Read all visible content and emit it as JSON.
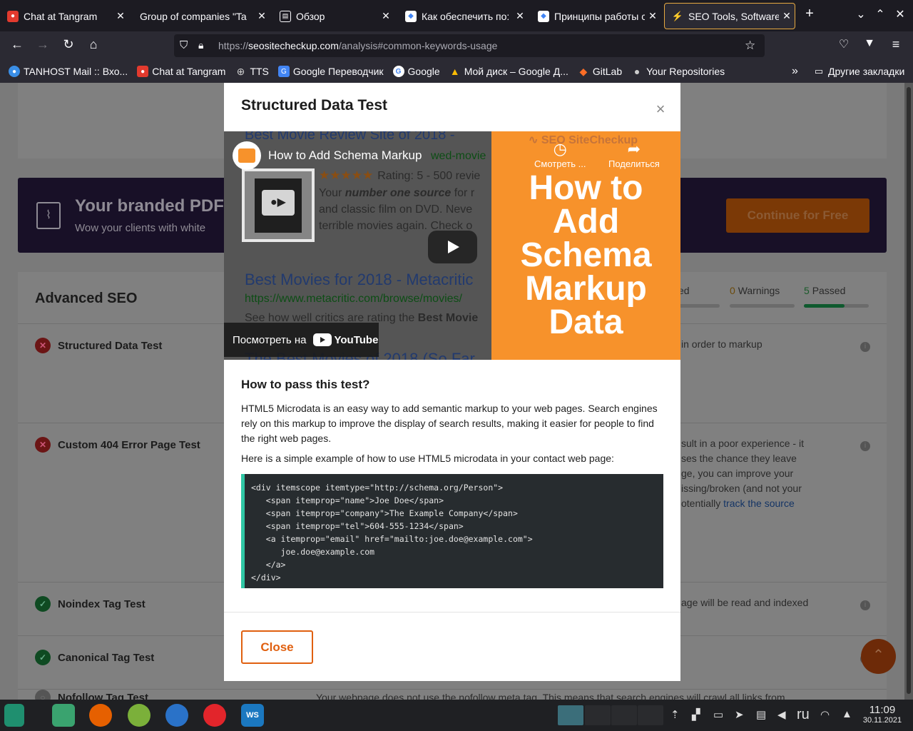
{
  "tabs": [
    {
      "label": "Chat at Tangram",
      "icon": "chat-icon",
      "color": "#e23a2e"
    },
    {
      "label": "Group of companies \"Ta",
      "icon": "",
      "color": ""
    },
    {
      "label": "Обзор",
      "icon": "page-icon",
      "color": "#fbfbfe"
    },
    {
      "label": "Как обеспечить по:",
      "icon": "google-dev-icon",
      "color": "#4285f4"
    },
    {
      "label": "Принципы работы с",
      "icon": "google-dev-icon",
      "color": "#4285f4"
    },
    {
      "label": "SEO Tools, Software",
      "icon": "seo-icon",
      "color": "#f7922b"
    }
  ],
  "toolbar": {
    "new_tab": "+"
  },
  "url": {
    "scheme": "https://",
    "host": "seositecheckup.com",
    "path": "/analysis#common-keywords-usage"
  },
  "bookmarks": [
    {
      "label": "TANHOST Mail :: Вхо...",
      "icon": "mail-icon",
      "color": "#3a8ee6"
    },
    {
      "label": "Chat at Tangram",
      "icon": "chat-icon",
      "color": "#e23a2e"
    },
    {
      "label": "TTS",
      "icon": "globe-icon",
      "color": "#cccccc"
    },
    {
      "label": "Google Переводчик",
      "icon": "translate-icon",
      "color": "#4285f4"
    },
    {
      "label": "Google",
      "icon": "google-icon",
      "color": "#ffffff"
    },
    {
      "label": "Мой диск – Google Д...",
      "icon": "drive-icon",
      "color": "#fbbc04"
    },
    {
      "label": "GitLab",
      "icon": "gitlab-icon",
      "color": "#fc6d26"
    },
    {
      "label": "Your Repositories",
      "icon": "github-icon",
      "color": "#cccccc"
    }
  ],
  "bookmarks_other": "Другие закладки",
  "banner": {
    "title": "Your branded PDF",
    "subtitle": "Wow your clients with white",
    "cta": "Continue for Free"
  },
  "advanced_seo": {
    "title": "Advanced SEO",
    "stats": {
      "failed_label": "ed",
      "warnings_count": "0",
      "warnings_label": "Warnings",
      "passed_count": "5",
      "passed_label": "Passed"
    },
    "passed_fraction": 0.63,
    "rows": [
      {
        "name": "Structured Data Test",
        "status": "fail",
        "text": "in order to markup"
      },
      {
        "name": "Custom 404 Error Page Test",
        "status": "fail",
        "text_lines": [
          "sult in a poor experience - it",
          "ses the chance they leave",
          "ge, you can improve your",
          "issing/broken (and not your",
          "otentially "
        ],
        "link": "track the source"
      },
      {
        "name": "Noindex Tag Test",
        "status": "pass",
        "text": "age will be read and indexed"
      },
      {
        "name": "Canonical Tag Test",
        "status": "pass",
        "text": ""
      },
      {
        "name": "Nofollow Tag Test",
        "status": "neutral",
        "text": "Your webpage does not use the nofollow meta tag. This means that search engines will crawl all links from"
      }
    ]
  },
  "modal": {
    "title": "Structured Data Test",
    "close_x": "×",
    "video": {
      "title": "How to Add Schema Markup",
      "brand": "SEO SiteCheckup",
      "big_text": [
        "How to",
        "Add",
        "Schema",
        "Markup",
        "Data"
      ],
      "watch_later": "Смотреть ...",
      "share": "Поделиться",
      "watch_on": "Посмотреть на",
      "youtube": "YouTube",
      "bg_lines": {
        "l1": "Best Movie Review Site of 2018 -",
        "l2": "wed-movie",
        "rating": "Rating: 5 - 500 revie",
        "desc1_a": "Your ",
        "desc1_b": "number one source",
        "desc1_c": " for r",
        "desc2": "and classic film on DVD. Neve",
        "desc3": "terrible movies again. Check o",
        "r2_title": "Best Movies for 2018 - Metacritic",
        "r2_url": "https://www.metacritic.com/browse/movies/",
        "r2_desc_a": "See how well critics are rating the ",
        "r2_desc_b": "Best Movie",
        "r3_title": "The Best Movies of 2018 (So Far"
      }
    },
    "how_to_title": "How to pass this test?",
    "paragraph": "HTML5 Microdata is an easy way to add semantic markup to your web pages. Search engines rely on this markup to improve the display of search results, making it easier for people to find the right web pages.",
    "example_intro": "Here is a simple example of how to use HTML5 microdata in your contact web page:",
    "code_lines": [
      "<div itemscope itemtype=\"http://schema.org/Person\">",
      "   <span itemprop=\"name\">Joe Doe</span>",
      "   <span itemprop=\"company\">The Example Company</span>",
      "   <span itemprop=\"tel\">604-555-1234</span>",
      "   <a itemprop=\"email\" href=\"mailto:joe.doe@example.com\">",
      "      joe.doe@example.com",
      "   </a>",
      "</div>"
    ],
    "close_button": "Close"
  },
  "taskbar": {
    "lang": "ru",
    "time": "11:09",
    "date": "30.11.2021"
  }
}
